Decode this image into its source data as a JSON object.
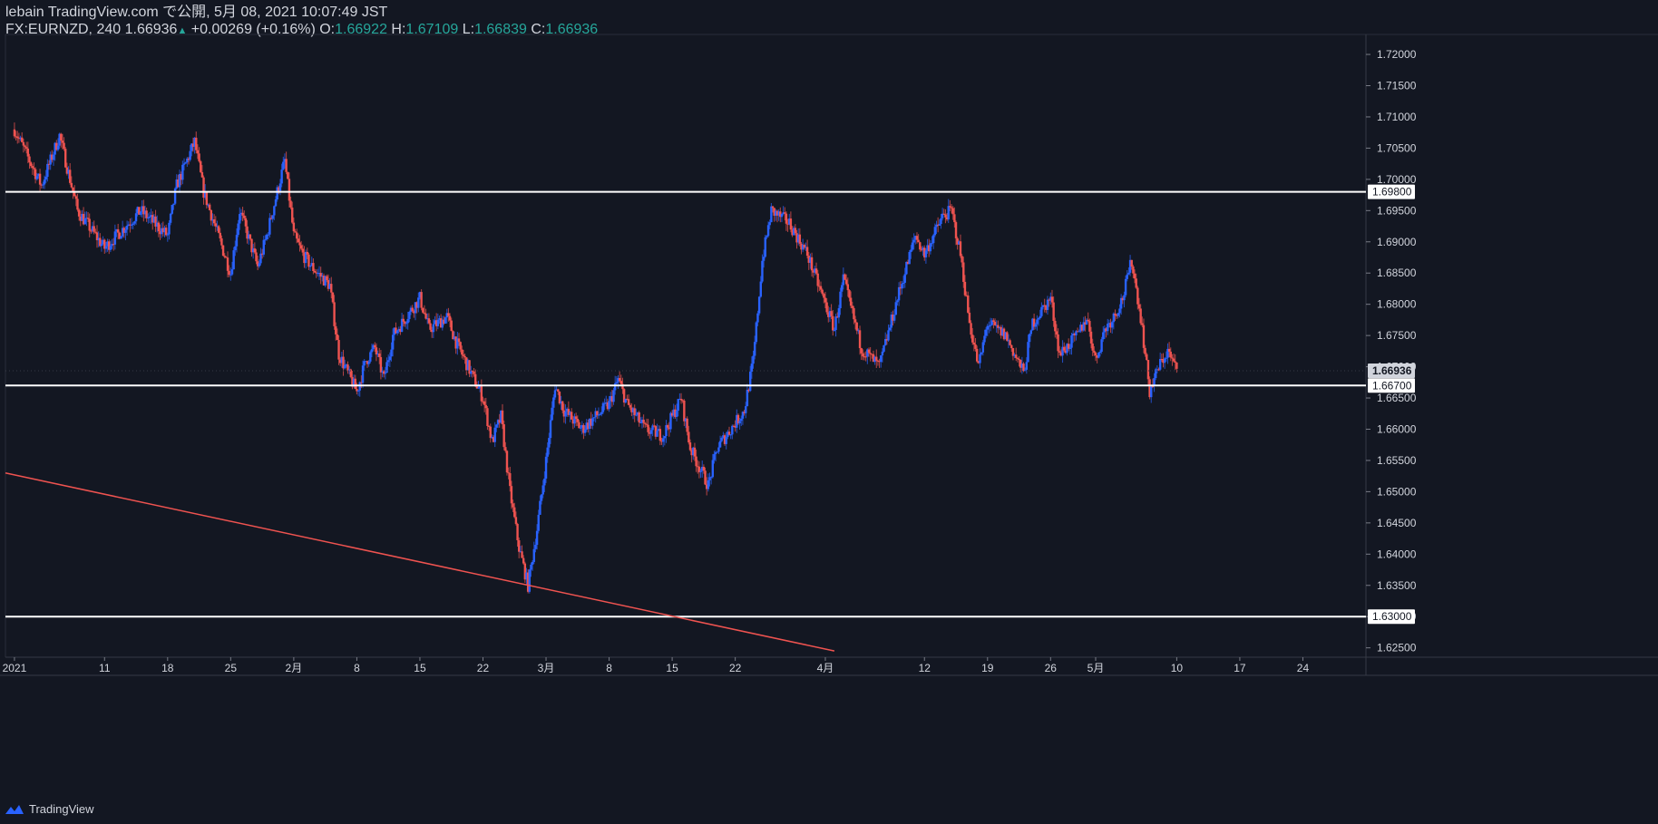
{
  "header": {
    "published": "lebain TradingView.com で公開, 5月 08, 2021 10:07:49 JST",
    "symbol": "FX:EURNZD, 240",
    "last": "1.66936",
    "change": "+0.00269 (+0.16%)",
    "o_label": "O:",
    "o": "1.66922",
    "h_label": "H:",
    "h": "1.67109",
    "l_label": "L:",
    "l": "1.66839",
    "c_label": "C:",
    "c": "1.66936"
  },
  "footer": {
    "brand": "TradingView"
  },
  "colors": {
    "background": "#131722",
    "up": "#2962ff",
    "down": "#ef5350",
    "hline": "#ffffff",
    "trendline": "#ef5350",
    "price_up_text": "#26a69a"
  },
  "chart_data": {
    "type": "candlestick",
    "title": "",
    "ylim": [
      1.6235,
      1.7232
    ],
    "price_ticks": [
      "1.72000",
      "1.71500",
      "1.71000",
      "1.70500",
      "1.70000",
      "1.69500",
      "1.69000",
      "1.68500",
      "1.68000",
      "1.67500",
      "1.67000",
      "1.66500",
      "1.66000",
      "1.65500",
      "1.65000",
      "1.64500",
      "1.64000",
      "1.63500",
      "1.63000",
      "1.62500"
    ],
    "x_ticks": [
      "2021",
      "11",
      "18",
      "25",
      "2月",
      "8",
      "15",
      "22",
      "3月",
      "8",
      "15",
      "22",
      "4月",
      "12",
      "19",
      "26",
      "5月",
      "10",
      "17",
      "24"
    ],
    "x_tick_dates": [
      "2021-01-01",
      "2021-01-11",
      "2021-01-18",
      "2021-01-25",
      "2021-02-01",
      "2021-02-08",
      "2021-02-15",
      "2021-02-22",
      "2021-03-01",
      "2021-03-08",
      "2021-03-15",
      "2021-03-22",
      "2021-04-01",
      "2021-04-12",
      "2021-04-19",
      "2021-04-26",
      "2021-05-01",
      "2021-05-10",
      "2021-05-17",
      "2021-05-24"
    ],
    "x_range": [
      "2020-12-31",
      "2021-05-31"
    ],
    "grid": false,
    "horizontal_levels": [
      "1.69800",
      "1.66700",
      "1.63000"
    ],
    "current_price": "1.66936",
    "trendline": {
      "start": {
        "date": "2020-12-31",
        "price": 1.653
      },
      "end": {
        "date": "2021-04-02",
        "price": 1.6245
      }
    },
    "close_path": [
      [
        "2021-01-01",
        1.708
      ],
      [
        "2021-01-04",
        1.699
      ],
      [
        "2021-01-06",
        1.707
      ],
      [
        "2021-01-07",
        1.701
      ],
      [
        "2021-01-08",
        1.695
      ],
      [
        "2021-01-11",
        1.689
      ],
      [
        "2021-01-13",
        1.692
      ],
      [
        "2021-01-15",
        1.695
      ],
      [
        "2021-01-18",
        1.691
      ],
      [
        "2021-01-19",
        1.699
      ],
      [
        "2021-01-21",
        1.706
      ],
      [
        "2021-01-22",
        1.698
      ],
      [
        "2021-01-25",
        1.685
      ],
      [
        "2021-01-26",
        1.695
      ],
      [
        "2021-01-28",
        1.686
      ],
      [
        "2021-01-29",
        1.691
      ],
      [
        "2021-01-31",
        1.703
      ],
      [
        "2021-02-01",
        1.691
      ],
      [
        "2021-02-02",
        1.688
      ],
      [
        "2021-02-03",
        1.686
      ],
      [
        "2021-02-05",
        1.683
      ],
      [
        "2021-02-06",
        1.672
      ],
      [
        "2021-02-08",
        1.666
      ],
      [
        "2021-02-09",
        1.671
      ],
      [
        "2021-02-10",
        1.673
      ],
      [
        "2021-02-11",
        1.668
      ],
      [
        "2021-02-12",
        1.675
      ],
      [
        "2021-02-15",
        1.681
      ],
      [
        "2021-02-16",
        1.676
      ],
      [
        "2021-02-18",
        1.678
      ],
      [
        "2021-02-19",
        1.674
      ],
      [
        "2021-02-22",
        1.665
      ],
      [
        "2021-02-23",
        1.658
      ],
      [
        "2021-02-24",
        1.662
      ],
      [
        "2021-02-25",
        1.65
      ],
      [
        "2021-02-26",
        1.641
      ],
      [
        "2021-02-27",
        1.635
      ],
      [
        "2021-02-28",
        1.644
      ],
      [
        "2021-03-01",
        1.655
      ],
      [
        "2021-03-02",
        1.667
      ],
      [
        "2021-03-03",
        1.663
      ],
      [
        "2021-03-05",
        1.66
      ],
      [
        "2021-03-08",
        1.664
      ],
      [
        "2021-03-09",
        1.668
      ],
      [
        "2021-03-10",
        1.664
      ],
      [
        "2021-03-11",
        1.662
      ],
      [
        "2021-03-12",
        1.66
      ],
      [
        "2021-03-14",
        1.659
      ],
      [
        "2021-03-16",
        1.665
      ],
      [
        "2021-03-17",
        1.657
      ],
      [
        "2021-03-19",
        1.651
      ],
      [
        "2021-03-20",
        1.657
      ],
      [
        "2021-03-22",
        1.661
      ],
      [
        "2021-03-23",
        1.663
      ],
      [
        "2021-03-24",
        1.671
      ],
      [
        "2021-03-25",
        1.687
      ],
      [
        "2021-03-26",
        1.695
      ],
      [
        "2021-03-28",
        1.693
      ],
      [
        "2021-03-30",
        1.688
      ],
      [
        "2021-04-01",
        1.68
      ],
      [
        "2021-04-02",
        1.676
      ],
      [
        "2021-04-03",
        1.684
      ],
      [
        "2021-04-05",
        1.673
      ],
      [
        "2021-04-07",
        1.67
      ],
      [
        "2021-04-09",
        1.681
      ],
      [
        "2021-04-11",
        1.691
      ],
      [
        "2021-04-12",
        1.688
      ],
      [
        "2021-04-14",
        1.694
      ],
      [
        "2021-04-15",
        1.695
      ],
      [
        "2021-04-16",
        1.688
      ],
      [
        "2021-04-17",
        1.677
      ],
      [
        "2021-04-18",
        1.67
      ],
      [
        "2021-04-19",
        1.677
      ],
      [
        "2021-04-21",
        1.675
      ],
      [
        "2021-04-22",
        1.672
      ],
      [
        "2021-04-23",
        1.669
      ],
      [
        "2021-04-24",
        1.677
      ],
      [
        "2021-04-26",
        1.681
      ],
      [
        "2021-04-27",
        1.672
      ],
      [
        "2021-04-29",
        1.675
      ],
      [
        "2021-04-30",
        1.678
      ],
      [
        "2021-05-01",
        1.671
      ],
      [
        "2021-05-02",
        1.676
      ],
      [
        "2021-05-03",
        1.678
      ],
      [
        "2021-05-04",
        1.681
      ],
      [
        "2021-05-05",
        1.687
      ],
      [
        "2021-05-06",
        1.678
      ],
      [
        "2021-05-07",
        1.666
      ],
      [
        "2021-05-08",
        1.67
      ],
      [
        "2021-05-09",
        1.6725
      ],
      [
        "2021-05-10",
        1.6694
      ]
    ],
    "last_date": "2021-05-10"
  }
}
